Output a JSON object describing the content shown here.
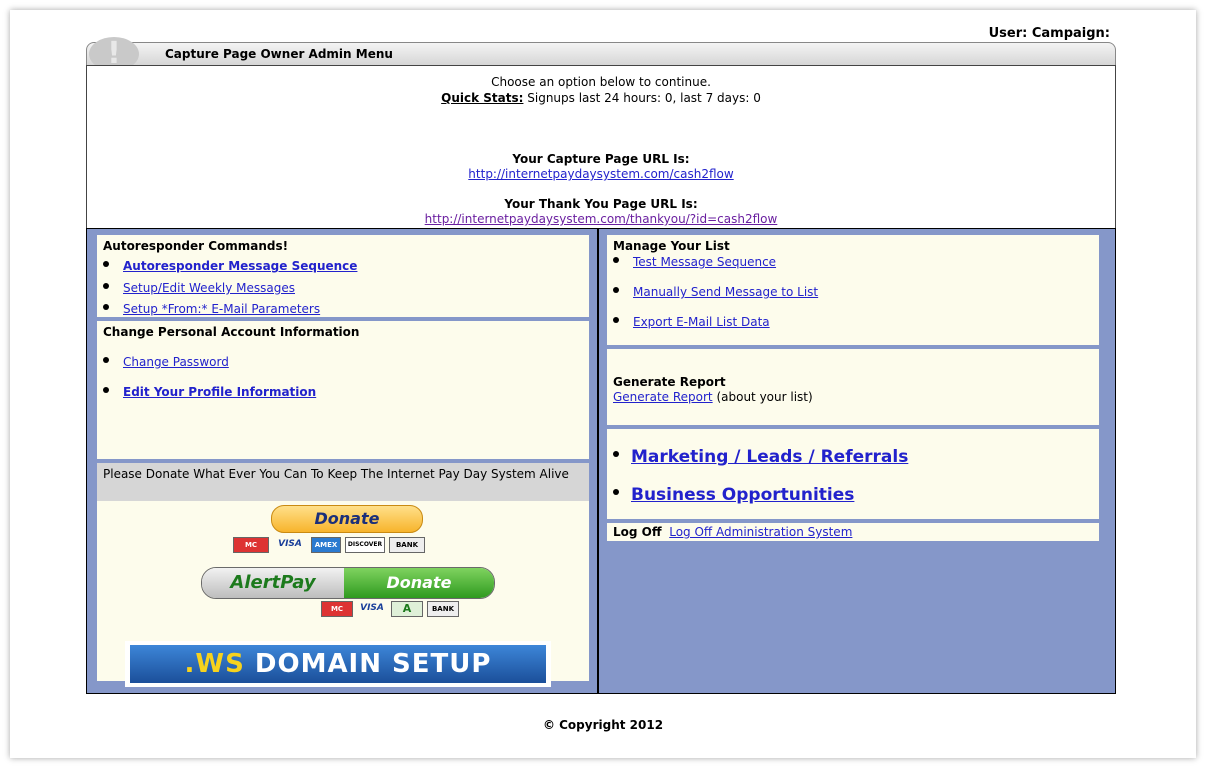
{
  "header": {
    "user_label": "User:  Campaign:"
  },
  "title_bar": {
    "title": "Capture Page Owner Admin Menu",
    "icon_glyph": "!"
  },
  "info": {
    "choose_text": "Choose an option below to continue.",
    "quick_stats_label": "Quick Stats:",
    "quick_stats_text": " Signups last 24 hours: 0, last 7 days: 0",
    "capture_heading": "Your Capture Page URL Is:",
    "capture_url": "http://internetpaydaysystem.com/cash2flow",
    "thankyou_heading": "Your Thank You Page URL Is:",
    "thankyou_url": "http://internetpaydaysystem.com/thankyou/?id=cash2flow"
  },
  "autoresponder": {
    "heading": "Autoresponder Commands!",
    "items": [
      {
        "label": "Autoresponder Message Sequence"
      },
      {
        "label": "Setup/Edit Weekly Messages"
      },
      {
        "label": "Setup *From:* E-Mail Parameters"
      }
    ]
  },
  "account": {
    "heading": "Change Personal Account Information",
    "items": [
      {
        "label": "Change Password"
      },
      {
        "label": "Edit Your Profile Information"
      }
    ]
  },
  "donate": {
    "text": "Please Donate What Ever You Can To Keep The Internet Pay Day System Alive",
    "donate_button": "Donate",
    "cards": [
      "MC",
      "VISA",
      "AMEX",
      "DISCOVER",
      "BANK"
    ],
    "alertpay_left": "AlertPay",
    "alertpay_right": "Donate",
    "alertpay_cards": [
      "MC",
      "VISA",
      "A",
      "BANK"
    ],
    "ws_prefix": ".WS",
    "ws_text": " DOMAIN SETUP"
  },
  "manage_list": {
    "heading": "Manage Your List",
    "items": [
      {
        "label": "Test Message Sequence"
      },
      {
        "label": "Manually Send Message to List"
      },
      {
        "label": "Export E-Mail List Data"
      }
    ]
  },
  "report": {
    "heading": "Generate Report",
    "link": "Generate Report",
    "suffix": " (about your list)"
  },
  "marketing": {
    "items": [
      {
        "label": "Marketing / Leads / Referrals"
      },
      {
        "label": "Business Opportunities"
      }
    ]
  },
  "logoff": {
    "label": "Log Off",
    "link": "Log Off Administration System"
  },
  "footer": {
    "copyright": "© Copyright 2012"
  },
  "colors": {
    "panel_bg": "#fdfcec",
    "frame_bg": "#8597c9",
    "link": "#2222cc"
  }
}
